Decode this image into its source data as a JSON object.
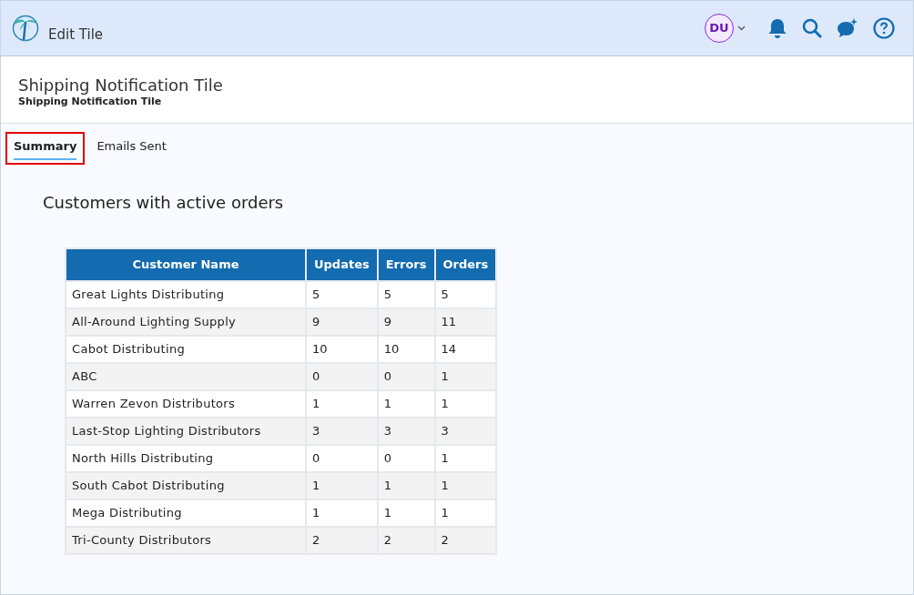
{
  "header": {
    "title": "Edit Tile",
    "avatar": "DU"
  },
  "page": {
    "title": "Shipping Notification Tile",
    "subtitle": "Shipping Notification Tile"
  },
  "tabs": [
    {
      "label": "Summary",
      "selected": true
    },
    {
      "label": "Emails Sent",
      "selected": false
    }
  ],
  "section_title": "Customers with active orders",
  "table": {
    "columns": [
      "Customer Name",
      "Updates",
      "Errors",
      "Orders"
    ],
    "rows": [
      [
        "Great Lights Distributing",
        "5",
        "5",
        "5"
      ],
      [
        "All-Around Lighting Supply",
        "9",
        "9",
        "11"
      ],
      [
        "Cabot Distributing",
        "10",
        "10",
        "14"
      ],
      [
        "ABC",
        "0",
        "0",
        "1"
      ],
      [
        "Warren Zevon Distributors",
        "1",
        "1",
        "1"
      ],
      [
        "Last-Stop Lighting Distributors",
        "3",
        "3",
        "3"
      ],
      [
        "North Hills Distributing",
        "0",
        "0",
        "1"
      ],
      [
        "South Cabot Distributing",
        "1",
        "1",
        "1"
      ],
      [
        "Mega Distributing",
        "1",
        "1",
        "1"
      ],
      [
        "Tri-County Distributors",
        "2",
        "2",
        "2"
      ]
    ]
  }
}
